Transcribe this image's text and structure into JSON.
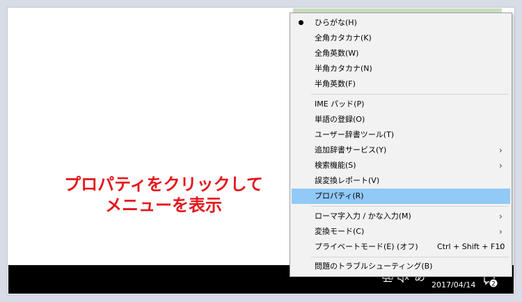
{
  "annotation": {
    "line1": "プロパティをクリックして",
    "line2": "メニューを表示"
  },
  "menu": {
    "items": [
      {
        "label": "ひらがな(H)",
        "checked": true
      },
      {
        "label": "全角カタカナ(K)"
      },
      {
        "label": "全角英数(W)"
      },
      {
        "label": "半角カタカナ(N)"
      },
      {
        "label": "半角英数(F)"
      },
      {
        "label": "IME パッド(P)"
      },
      {
        "label": "単語の登録(O)"
      },
      {
        "label": "ユーザー辞書ツール(T)"
      },
      {
        "label": "追加辞書サービス(Y)",
        "submenu": true
      },
      {
        "label": "検索機能(S)",
        "submenu": true
      },
      {
        "label": "誤変換レポート(V)"
      },
      {
        "label": "プロパティ(R)",
        "selected": true
      },
      {
        "label": "ローマ字入力 / かな入力(M)",
        "submenu": true
      },
      {
        "label": "変換モード(C)",
        "submenu": true
      },
      {
        "label": "プライベートモード(E) (オフ)",
        "shortcut": "Ctrl + Shift + F10",
        "submenu": true
      },
      {
        "label": "問題のトラブルシューティング(B)"
      }
    ],
    "arrow_glyph": "›"
  },
  "taskbar": {
    "chevron": "^",
    "ime_indicator": "あ",
    "date": "2017/04/14",
    "notification_count": "2"
  },
  "colors": {
    "annotation": "#e4161b",
    "selected": "#91c9f7",
    "taskbar": "#000000",
    "menu_bg": "#f2f2f2"
  }
}
